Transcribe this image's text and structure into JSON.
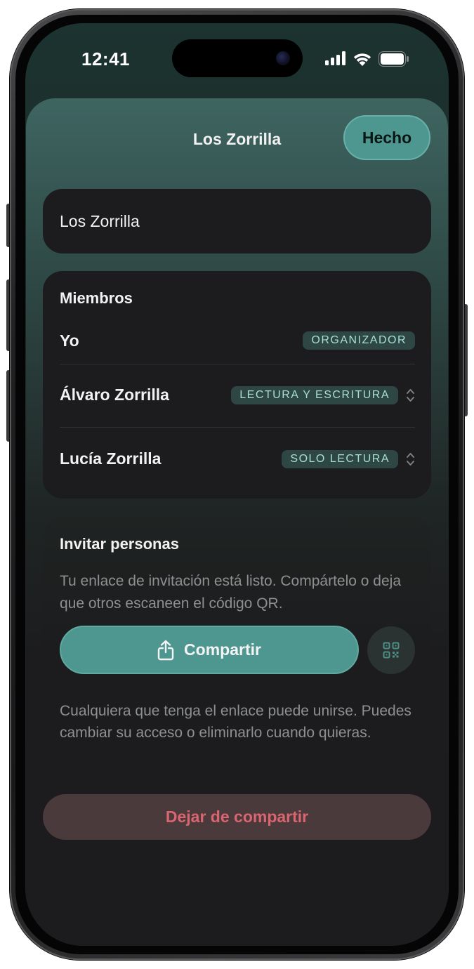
{
  "status_bar": {
    "time": "12:41",
    "icons": [
      "cellular-signal-icon",
      "wifi-icon",
      "battery-icon"
    ]
  },
  "sheet": {
    "title": "Los Zorrilla",
    "done_label": "Hecho"
  },
  "group_name": {
    "value": "Los Zorrilla"
  },
  "members": {
    "heading": "Miembros",
    "items": [
      {
        "name": "Yo",
        "role": "ORGANIZADOR",
        "editable": false
      },
      {
        "name": "Álvaro Zorrilla",
        "role": "LECTURA Y ESCRITURA",
        "editable": true
      },
      {
        "name": "Lucía Zorrilla",
        "role": "SOLO LECTURA",
        "editable": true
      }
    ]
  },
  "invite": {
    "heading": "Invitar personas",
    "description": "Tu enlace de invitación está listo. Compártelo o deja que otros escaneen el código QR.",
    "share_label": "Compartir",
    "footnote": "Cualquiera que tenga el enlace puede unirse. Puedes cambiar su acceso o eliminarlo cuando quieras."
  },
  "stop_sharing_label": "Dejar de compartir",
  "colors": {
    "accent": "#4e9790",
    "badge_bg": "#2f4744",
    "badge_text": "#a8dfd7",
    "destructive": "#d8656f",
    "card_bg": "#1c1c1e"
  }
}
